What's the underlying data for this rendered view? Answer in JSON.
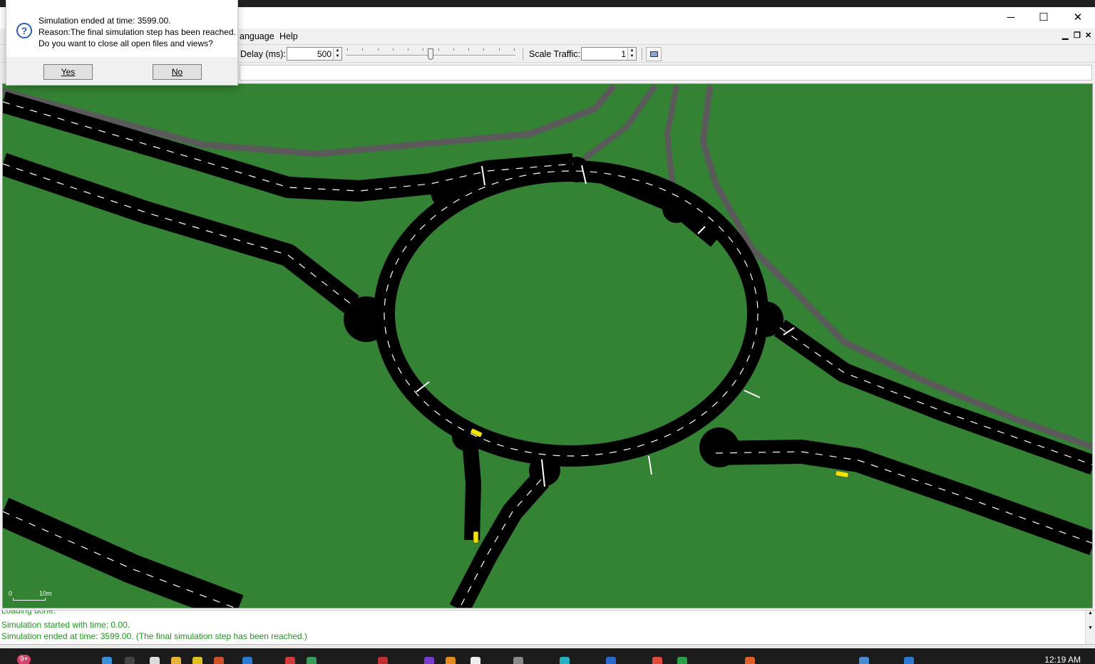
{
  "window": {
    "controls": {
      "minimize": "─",
      "maximize": "☐",
      "close": "✕"
    },
    "mdi_controls": {
      "minimize": "▁",
      "restore": "❐",
      "close": "✕"
    }
  },
  "menu": {
    "items": [
      "anguage",
      "Help"
    ]
  },
  "toolbar": {
    "delay_label": "Delay (ms):",
    "delay_value": "500",
    "delay_slider_fraction": 0.5,
    "scale_label": "Scale Traffic:",
    "scale_value": "1"
  },
  "dialog": {
    "line1": "Simulation ended at time: 3599.00.",
    "line2": "Reason:The final simulation step has been reached.",
    "line3": "Do you want to close all open files and views?",
    "yes_label": "Yes",
    "no_label": "No"
  },
  "scale_bar": {
    "start": "0",
    "end": "10m"
  },
  "log": {
    "lines": [
      "Loading done.",
      "Simulation started with time: 0.00.",
      "Simulation ended at time: 3599.00. (The final simulation step has been reached.)"
    ]
  },
  "taskbar": {
    "badge": "9+",
    "clock": "12:19 AM"
  },
  "colors": {
    "grass": "#348234",
    "road": "#000000",
    "sidewalk": "#5a5a5a",
    "lane_marking": "#ffffff",
    "vehicle": "#f2e200",
    "log_text": "#1a9a1a"
  }
}
